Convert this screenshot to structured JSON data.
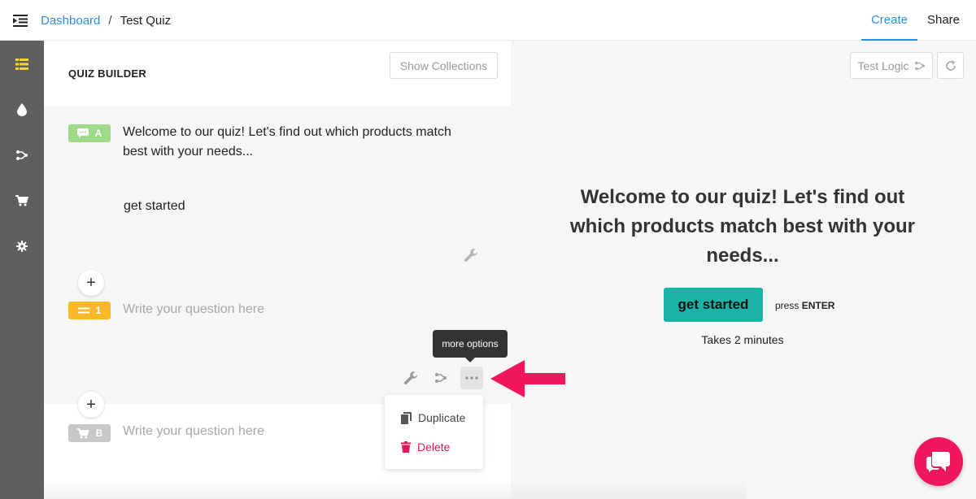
{
  "breadcrumb": {
    "root": "Dashboard",
    "separator": "/",
    "current": "Test Quiz"
  },
  "top_tabs": [
    {
      "label": "Create",
      "active": true
    },
    {
      "label": "Share",
      "active": false
    }
  ],
  "sidebar": {
    "items": [
      {
        "icon": "list-icon",
        "active": true
      },
      {
        "icon": "drop-icon"
      },
      {
        "icon": "logic-icon"
      },
      {
        "icon": "cart-icon"
      },
      {
        "icon": "gear-icon"
      }
    ]
  },
  "builder": {
    "title": "QUIZ BUILDER",
    "show_collections": "Show Collections",
    "welcome": {
      "badge": "A",
      "text": "Welcome to our quiz! Let's find out which products match best with your needs...",
      "button_label": "get started"
    },
    "question1": {
      "badge": "1",
      "placeholder": "Write your question here"
    },
    "questionB": {
      "badge": "B",
      "placeholder": "Write your question here"
    },
    "tooltip": "more options",
    "menu": {
      "duplicate": "Duplicate",
      "delete": "Delete"
    }
  },
  "preview": {
    "test_logic": "Test Logic",
    "title": "Welcome to our quiz! Let's find out which products match best with your needs...",
    "start_button": "get started",
    "press_label": "press",
    "press_key": "ENTER",
    "duration": "Takes 2 minutes"
  },
  "colors": {
    "accent": "#2b8fe0",
    "welcome_badge": "#9fd98a",
    "question_badge": "#fbb829",
    "product_badge": "#c7c7c7",
    "start_button": "#1ab3a8",
    "delete": "#e2185b",
    "arrow": "#f0175c",
    "sidebar_active": "#f5d327"
  }
}
